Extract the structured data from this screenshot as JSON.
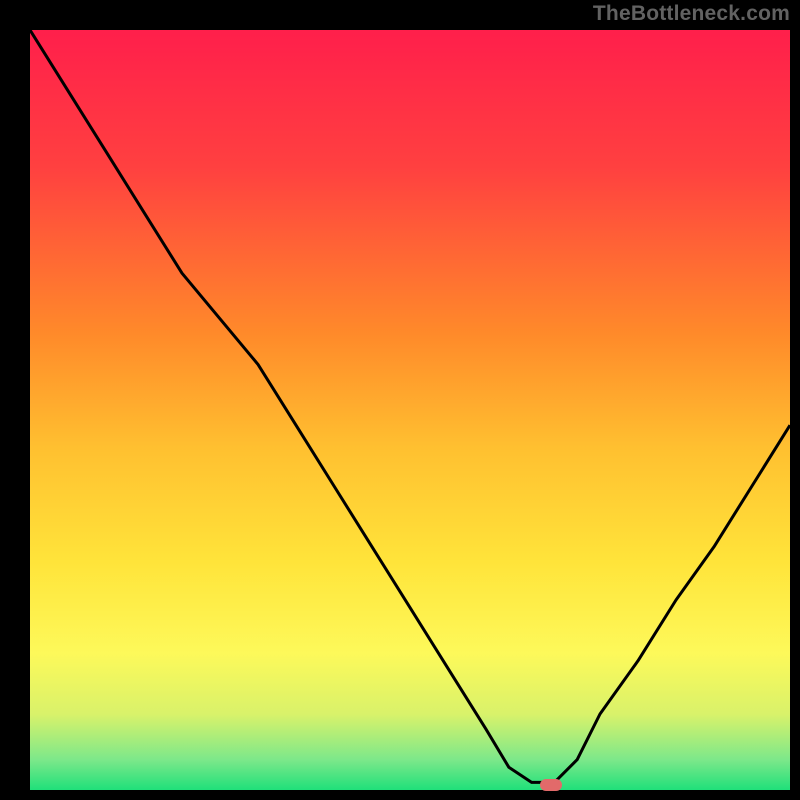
{
  "watermark": "TheBottleneck.com",
  "chart_data": {
    "type": "line",
    "title": "",
    "xlabel": "",
    "ylabel": "",
    "xlim": [
      0,
      100
    ],
    "ylim": [
      0,
      100
    ],
    "x": [
      0,
      5,
      10,
      15,
      20,
      25,
      30,
      35,
      40,
      45,
      50,
      55,
      60,
      63,
      66,
      69,
      72,
      75,
      80,
      85,
      90,
      95,
      100
    ],
    "values": [
      100,
      92,
      84,
      76,
      68,
      62,
      56,
      48,
      40,
      32,
      24,
      16,
      8,
      3,
      1,
      1,
      4,
      10,
      17,
      25,
      32,
      40,
      48
    ],
    "gradient_stops": [
      {
        "offset": 0,
        "color": "#ff1f4b"
      },
      {
        "offset": 0.18,
        "color": "#ff4040"
      },
      {
        "offset": 0.4,
        "color": "#ff8a2a"
      },
      {
        "offset": 0.55,
        "color": "#ffc030"
      },
      {
        "offset": 0.7,
        "color": "#ffe43a"
      },
      {
        "offset": 0.82,
        "color": "#fdf95a"
      },
      {
        "offset": 0.9,
        "color": "#d9f26a"
      },
      {
        "offset": 0.96,
        "color": "#7de88a"
      },
      {
        "offset": 1.0,
        "color": "#1fe07a"
      }
    ],
    "marker": {
      "x": 68.5,
      "y": 0.6,
      "color": "#e26a6a"
    }
  }
}
